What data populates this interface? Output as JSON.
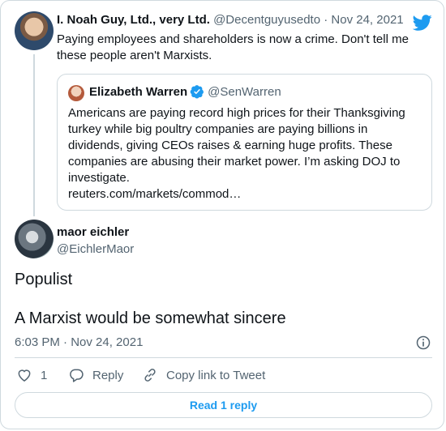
{
  "colors": {
    "accent": "#1d9bf0",
    "text": "#0f1419",
    "muted": "#536471",
    "border": "#cfd9de"
  },
  "parent": {
    "name": "I. Noah Guy, Ltd., very Ltd.",
    "handle": "@Decentguyusedto",
    "sep": " · ",
    "date": "Nov 24, 2021",
    "text": "Paying employees and shareholders is now a crime. Don't tell me these people aren't Marxists."
  },
  "quoted": {
    "name": "Elizabeth Warren",
    "handle": "@SenWarren",
    "text": "Americans are paying record high prices for their Thanksgiving turkey while big poultry companies are paying billions in dividends, giving CEOs raises & earning huge profits. These companies are abusing their market power. I’m asking DOJ to investigate.",
    "link": "reuters.com/markets/commod…"
  },
  "tweet": {
    "name": "maor eichler",
    "handle": "@EichlerMaor",
    "line1": "Populist",
    "line2": "A Marxist would be somewhat sincere",
    "timestamp": "6:03 PM · Nov 24, 2021",
    "like_count": "1",
    "reply_label": "Reply",
    "copy_label": "Copy link to Tweet",
    "read_label": "Read 1 reply"
  },
  "icons": {
    "bird": "twitter-bird-icon",
    "verified": "verified-badge-icon",
    "info": "info-icon",
    "like": "heart-icon",
    "reply": "reply-bubble-icon",
    "copy": "link-icon"
  }
}
